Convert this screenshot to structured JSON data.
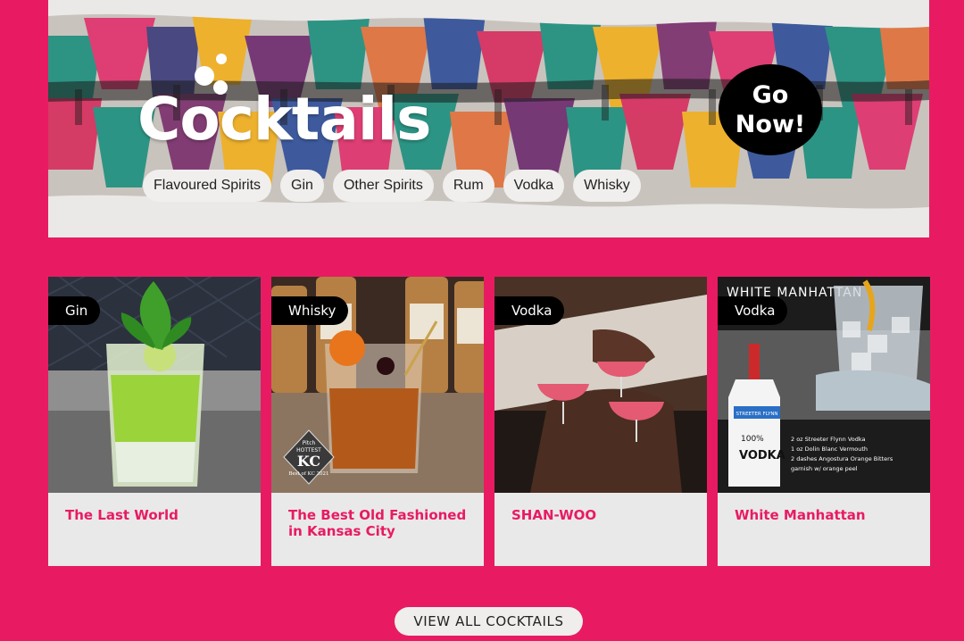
{
  "banner": {
    "title": "Cocktails",
    "go_line1": "Go",
    "go_line2": "Now!",
    "categories": [
      "Flavoured Spirits",
      "Gin",
      "Other Spirits",
      "Rum",
      "Vodka",
      "Whisky"
    ]
  },
  "cards": [
    {
      "tag": "Gin",
      "title": "The Last World"
    },
    {
      "tag": "Whisky",
      "title": "The Best Old Fashioned in Kansas City",
      "image_text": {
        "badge_line1": "Pitch",
        "badge_line2": "HOTTEST",
        "badge_line3": "KC",
        "badge_line4": "Best of KC 2021"
      }
    },
    {
      "tag": "Vodka",
      "title": "SHAN-WOO"
    },
    {
      "tag": "Vodka",
      "title": "White Manhattan",
      "image_text": {
        "heading": "WHITE MANHATTAN",
        "brand": "STREETER FLYNN",
        "bottle_line1": "100%",
        "bottle_line2": "VODKA",
        "recipe": [
          "2 oz Streeter Flynn Vodka",
          "1 oz Dolin Blanc Vermouth",
          "2 dashes Angostura Orange Bitters",
          "garnish w/ orange peel"
        ]
      }
    }
  ],
  "view_all": "VIEW ALL COCKTAILS",
  "colors": {
    "brand": "#e81b62",
    "card_bg": "#eae9e9",
    "tag_bg": "#000000"
  }
}
